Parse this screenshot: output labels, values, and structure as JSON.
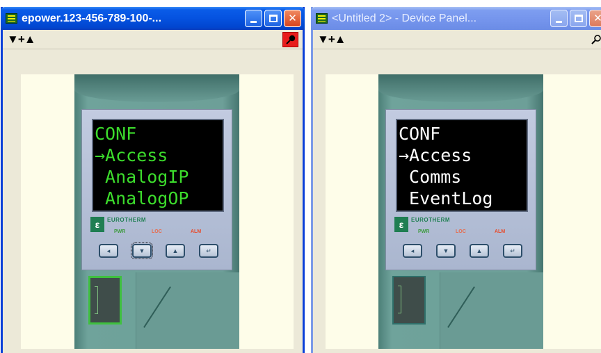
{
  "windows": [
    {
      "title": "epower.123-456-789-100-...",
      "toolbar": {
        "arrows": "▼+▲"
      },
      "device": {
        "lcd_lines": [
          "CONF",
          "→Access",
          " AnalogIP",
          " AnalogOP"
        ],
        "lcd_color": "#3cdc2c",
        "brand": "EUROTHERM",
        "labels": {
          "pwr": "PWR",
          "loc": "LOC",
          "alm": "ALM"
        }
      }
    },
    {
      "title": "<Untitled 2> - Device Panel...",
      "toolbar": {
        "arrows": "▼+▲"
      },
      "device": {
        "lcd_lines": [
          "CONF",
          "→Access",
          " Comms",
          " EventLog"
        ],
        "lcd_color": "#ffffff",
        "brand": "EUROTHERM",
        "labels": {
          "pwr": "PWR",
          "loc": "LOC",
          "alm": "ALM"
        }
      }
    }
  ],
  "colors": {
    "active_titlebar": "#0552e0",
    "inactive_titlebar": "#7494ec",
    "canvas_bg": "#fefde9",
    "device_body": "#6d9f98"
  },
  "icons": {
    "app": "panel-app-icon",
    "minimize": "minimize-icon",
    "maximize": "maximize-icon",
    "close": "close-icon",
    "pin": "pushpin-icon"
  }
}
